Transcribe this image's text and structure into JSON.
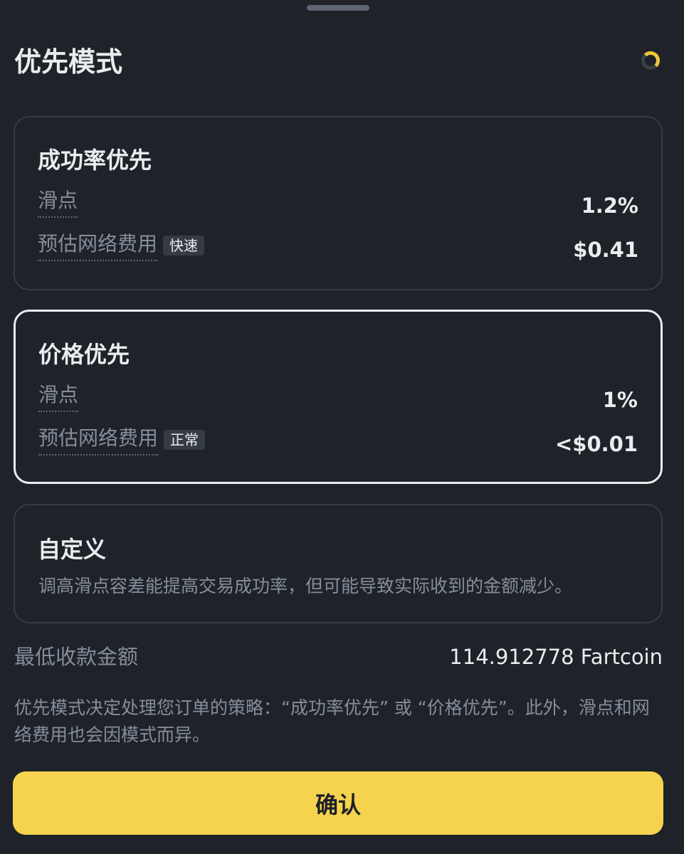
{
  "sheet": {
    "title": "优先模式",
    "spinner_icon": "loading-spinner-icon",
    "accent_color": "#f5d34f"
  },
  "options": [
    {
      "title": "成功率优先",
      "slippage_label": "滑点",
      "slippage_value": "1.2%",
      "fee_label": "预估网络费用",
      "fee_tag": "快速",
      "fee_value": "$0.41",
      "selected": false
    },
    {
      "title": "价格优先",
      "slippage_label": "滑点",
      "slippage_value": "1%",
      "fee_label": "预估网络费用",
      "fee_tag": "正常",
      "fee_value": "<$0.01",
      "selected": true
    }
  ],
  "custom": {
    "title": "自定义",
    "description": "调高滑点容差能提高交易成功率，但可能导致实际收到的金额减少。"
  },
  "minimum_received": {
    "label": "最低收款金额",
    "value": "114.912778 Fartcoin"
  },
  "note": "优先模式决定处理您订单的策略：“成功率优先” 或 “价格优先”。此外，滑点和网络费用也会因模式而异。",
  "confirm_label": "确认"
}
